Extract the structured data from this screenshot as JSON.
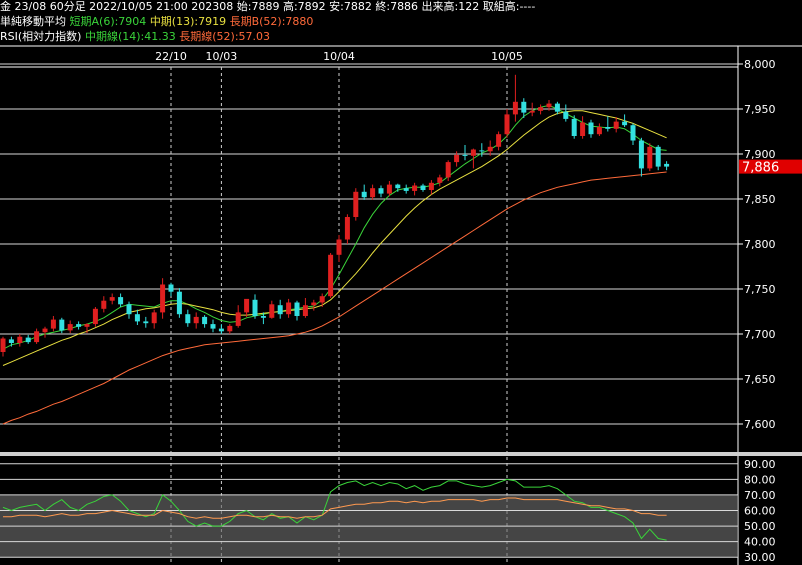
{
  "header": {
    "line1": "金 23/08 60分足 2022/10/05 21:00 202308 始:7889 高:7892 安:7882 終:7886 出来高:122 取組高:----",
    "ma_title": "単純移動平均",
    "ma_short": "短期A(6):7904",
    "ma_mid": "中期(13):7919",
    "ma_long": "長期B(52):7880",
    "rsi_title": "RSI(相対力指数)",
    "rsi_mid": "中期線(14):41.33",
    "rsi_long": "長期線(52):57.03"
  },
  "colors": {
    "up": "#e02020",
    "down": "#33e0e0",
    "ma6": "#3ad43a",
    "ma13": "#e8e040",
    "ma52": "#ff6a3a",
    "rsi14": "#3ad43a",
    "rsi52": "#ff9a50",
    "price_label_bg": "#e00000"
  },
  "chart_data": [
    {
      "type": "candlestick",
      "ylim": [
        7570,
        8020
      ],
      "yticks": [
        "8,000",
        "7,950",
        "7,900",
        "7,850",
        "7,800",
        "7,750",
        "7,700",
        "7,650",
        "7,600"
      ],
      "last_price_label": "7,886",
      "date_labels": [
        {
          "label": "22/10",
          "index": 20
        },
        {
          "label": "10/03",
          "index": 26
        },
        {
          "label": "10/04",
          "index": 40
        },
        {
          "label": "10/05",
          "index": 60
        }
      ],
      "candles": [
        [
          7680,
          7697,
          7675,
          7695
        ],
        [
          7694,
          7697,
          7686,
          7690
        ],
        [
          7690,
          7700,
          7686,
          7697
        ],
        [
          7696,
          7699,
          7689,
          7691
        ],
        [
          7691,
          7706,
          7689,
          7703
        ],
        [
          7702,
          7708,
          7696,
          7706
        ],
        [
          7706,
          7720,
          7703,
          7716
        ],
        [
          7716,
          7718,
          7701,
          7704
        ],
        [
          7704,
          7715,
          7701,
          7711
        ],
        [
          7711,
          7714,
          7705,
          7708
        ],
        [
          7708,
          7712,
          7701,
          7711
        ],
        [
          7711,
          7730,
          7708,
          7728
        ],
        [
          7728,
          7742,
          7724,
          7737
        ],
        [
          7737,
          7745,
          7733,
          7741
        ],
        [
          7741,
          7745,
          7730,
          7733
        ],
        [
          7733,
          7736,
          7717,
          7722
        ],
        [
          7722,
          7727,
          7710,
          7714
        ],
        [
          7714,
          7719,
          7707,
          7712
        ],
        [
          7712,
          7727,
          7706,
          7724
        ],
        [
          7724,
          7762,
          7717,
          7755
        ],
        [
          7755,
          7757,
          7742,
          7747
        ],
        [
          7747,
          7751,
          7718,
          7722
        ],
        [
          7722,
          7727,
          7708,
          7712
        ],
        [
          7712,
          7724,
          7706,
          7719
        ],
        [
          7719,
          7721,
          7707,
          7711
        ],
        [
          7711,
          7716,
          7702,
          7706
        ],
        [
          7706,
          7711,
          7700,
          7703
        ],
        [
          7703,
          7711,
          7700,
          7709
        ],
        [
          7709,
          7732,
          7707,
          7724
        ],
        [
          7724,
          7737,
          7719,
          7739
        ],
        [
          7738,
          7744,
          7717,
          7720
        ],
        [
          7720,
          7724,
          7711,
          7718
        ],
        [
          7718,
          7737,
          7717,
          7733
        ],
        [
          7732,
          7738,
          7717,
          7722
        ],
        [
          7722,
          7739,
          7718,
          7735
        ],
        [
          7735,
          7737,
          7715,
          7720
        ],
        [
          7720,
          7740,
          7718,
          7732
        ],
        [
          7732,
          7738,
          7726,
          7735
        ],
        [
          7735,
          7745,
          7730,
          7742
        ],
        [
          7742,
          7790,
          7740,
          7788
        ],
        [
          7788,
          7810,
          7780,
          7805
        ],
        [
          7805,
          7833,
          7800,
          7830
        ],
        [
          7830,
          7862,
          7826,
          7858
        ],
        [
          7858,
          7866,
          7849,
          7852
        ],
        [
          7852,
          7866,
          7849,
          7862
        ],
        [
          7862,
          7865,
          7852,
          7856
        ],
        [
          7856,
          7870,
          7853,
          7866
        ],
        [
          7866,
          7867,
          7858,
          7862
        ],
        [
          7862,
          7866,
          7856,
          7859
        ],
        [
          7859,
          7868,
          7854,
          7865
        ],
        [
          7865,
          7867,
          7858,
          7860
        ],
        [
          7860,
          7871,
          7855,
          7868
        ],
        [
          7868,
          7877,
          7864,
          7874
        ],
        [
          7874,
          7893,
          7870,
          7891
        ],
        [
          7891,
          7903,
          7886,
          7899
        ],
        [
          7899,
          7910,
          7893,
          7898
        ],
        [
          7898,
          7906,
          7884,
          7905
        ],
        [
          7904,
          7912,
          7897,
          7903
        ],
        [
          7903,
          7915,
          7898,
          7908
        ],
        [
          7908,
          7925,
          7904,
          7922
        ],
        [
          7922,
          7950,
          7918,
          7944
        ],
        [
          7944,
          7988,
          7936,
          7958
        ],
        [
          7958,
          7962,
          7940,
          7946
        ],
        [
          7946,
          7957,
          7942,
          7948
        ],
        [
          7948,
          7955,
          7944,
          7952
        ],
        [
          7952,
          7960,
          7948,
          7956
        ],
        [
          7956,
          7958,
          7944,
          7947
        ],
        [
          7947,
          7955,
          7936,
          7939
        ],
        [
          7939,
          7943,
          7917,
          7920
        ],
        [
          7920,
          7942,
          7917,
          7935
        ],
        [
          7935,
          7938,
          7918,
          7922
        ],
        [
          7922,
          7934,
          7920,
          7930
        ],
        [
          7930,
          7942,
          7925,
          7928
        ],
        [
          7928,
          7941,
          7924,
          7936
        ],
        [
          7936,
          7944,
          7930,
          7932
        ],
        [
          7932,
          7934,
          7910,
          7915
        ],
        [
          7915,
          7918,
          7875,
          7884
        ],
        [
          7884,
          7912,
          7881,
          7908
        ],
        [
          7908,
          7910,
          7882,
          7886
        ],
        [
          7889,
          7892,
          7882,
          7886
        ]
      ],
      "series": [
        {
          "name": "短期A(6)",
          "values": [
            7683,
            7688,
            7690,
            7693,
            7697,
            7700,
            7702,
            7704,
            7706,
            7709,
            7711,
            7714,
            7718,
            7724,
            7730,
            7733,
            7732,
            7731,
            7730,
            7734,
            7737,
            7737,
            7733,
            7728,
            7724,
            7719,
            7715,
            7713,
            7714,
            7718,
            7720,
            7722,
            7724,
            7725,
            7727,
            7728,
            7730,
            7731,
            7738,
            7750,
            7766,
            7783,
            7800,
            7818,
            7833,
            7845,
            7854,
            7860,
            7862,
            7863,
            7863,
            7865,
            7868,
            7875,
            7882,
            7889,
            7895,
            7901,
            7905,
            7911,
            7920,
            7932,
            7942,
            7948,
            7952,
            7954,
            7950,
            7945,
            7940,
            7935,
            7931,
            7930,
            7929,
            7930,
            7928,
            7922,
            7915,
            7910,
            7905,
            7904
          ]
        },
        {
          "name": "中期(13)",
          "values": [
            7665,
            7669,
            7673,
            7677,
            7681,
            7685,
            7689,
            7693,
            7696,
            7700,
            7703,
            7707,
            7711,
            7716,
            7720,
            7724,
            7726,
            7728,
            7729,
            7731,
            7733,
            7734,
            7733,
            7731,
            7729,
            7727,
            7724,
            7722,
            7721,
            7721,
            7722,
            7723,
            7724,
            7725,
            7726,
            7727,
            7728,
            7729,
            7732,
            7738,
            7747,
            7757,
            7767,
            7778,
            7790,
            7801,
            7811,
            7821,
            7831,
            7840,
            7848,
            7855,
            7861,
            7866,
            7871,
            7876,
            7881,
            7886,
            7892,
            7898,
            7905,
            7913,
            7921,
            7928,
            7935,
            7941,
            7945,
            7947,
            7948,
            7948,
            7946,
            7944,
            7942,
            7940,
            7937,
            7934,
            7930,
            7926,
            7922,
            7918
          ]
        },
        {
          "name": "長期B(52)",
          "values": [
            7600,
            7604,
            7607,
            7611,
            7614,
            7618,
            7622,
            7625,
            7629,
            7633,
            7637,
            7641,
            7645,
            7650,
            7655,
            7660,
            7664,
            7668,
            7672,
            7676,
            7679,
            7682,
            7684,
            7686,
            7688,
            7689,
            7690,
            7691,
            7692,
            7693,
            7694,
            7695,
            7696,
            7697,
            7698,
            7700,
            7702,
            7705,
            7709,
            7714,
            7719,
            7725,
            7731,
            7737,
            7743,
            7749,
            7755,
            7761,
            7767,
            7773,
            7779,
            7785,
            7791,
            7797,
            7803,
            7809,
            7815,
            7821,
            7827,
            7833,
            7839,
            7844,
            7849,
            7853,
            7857,
            7860,
            7863,
            7865,
            7867,
            7869,
            7871,
            7872,
            7873,
            7874,
            7875,
            7876,
            7877,
            7878,
            7879,
            7880
          ]
        }
      ]
    },
    {
      "type": "line",
      "ylim": [
        25,
        95
      ],
      "yticks": [
        "90.00",
        "80.00",
        "70.00",
        "60.00",
        "50.00",
        "40.00",
        "30.00"
      ],
      "band": [
        30,
        70
      ],
      "series": [
        {
          "name": "中期線(14)",
          "values": [
            62,
            60,
            62,
            63,
            64,
            60,
            64,
            67,
            62,
            60,
            64,
            66,
            69,
            70,
            66,
            60,
            58,
            56,
            58,
            70,
            66,
            60,
            53,
            50,
            52,
            50,
            50,
            53,
            58,
            60,
            56,
            54,
            58,
            55,
            56,
            52,
            56,
            54,
            57,
            72,
            76,
            78,
            79,
            76,
            78,
            76,
            78,
            77,
            74,
            76,
            73,
            75,
            76,
            79,
            79,
            77,
            76,
            75,
            76,
            78,
            80,
            79,
            75,
            75,
            75,
            76,
            74,
            70,
            66,
            65,
            62,
            62,
            60,
            58,
            56,
            52,
            42,
            48,
            42,
            41
          ]
        },
        {
          "name": "長期線(52)",
          "values": [
            56,
            56,
            57,
            57,
            57,
            56,
            57,
            58,
            57,
            57,
            58,
            58,
            59,
            60,
            59,
            58,
            57,
            57,
            57,
            60,
            59,
            58,
            56,
            55,
            56,
            55,
            55,
            56,
            57,
            57,
            56,
            56,
            57,
            56,
            56,
            55,
            56,
            56,
            57,
            61,
            62,
            63,
            64,
            64,
            65,
            65,
            66,
            66,
            65,
            66,
            65,
            66,
            66,
            67,
            67,
            67,
            67,
            66,
            67,
            67,
            68,
            68,
            67,
            67,
            67,
            67,
            67,
            66,
            65,
            64,
            63,
            63,
            62,
            61,
            61,
            60,
            58,
            58,
            57,
            57
          ]
        }
      ]
    }
  ]
}
